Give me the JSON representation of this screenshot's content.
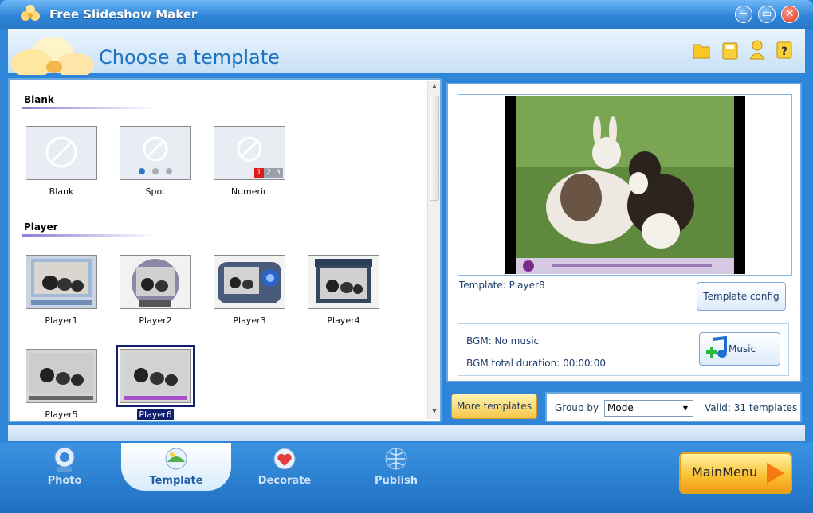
{
  "window": {
    "title": "Free Slideshow Maker",
    "controls": [
      "minimize",
      "maximize",
      "close"
    ]
  },
  "header": {
    "title": "Choose a template",
    "icons": [
      "folder-icon",
      "save-icon",
      "user-icon",
      "help-icon"
    ]
  },
  "templates": {
    "sections": [
      {
        "name": "Blank",
        "items": [
          {
            "label": "Blank"
          },
          {
            "label": "Spot"
          },
          {
            "label": "Numeric"
          }
        ]
      },
      {
        "name": "Player",
        "items": [
          {
            "label": "Player1"
          },
          {
            "label": "Player2"
          },
          {
            "label": "Player3"
          },
          {
            "label": "Player4"
          },
          {
            "label": "Player5"
          },
          {
            "label": "Player6",
            "selected": true
          }
        ]
      }
    ],
    "numeric_digits": [
      "1",
      "2",
      "3"
    ]
  },
  "preview": {
    "template_label": "Template:  Player8",
    "config_button": "Template config"
  },
  "bgm": {
    "music_line": "BGM: No music",
    "duration_line": "BGM total duration: 00:00:00",
    "music_button": "Music"
  },
  "controls": {
    "more_templates": "More templates",
    "group_by_label": "Group by",
    "group_by_value": "Mode",
    "valid_count": "Valid: 31 templates"
  },
  "tabs": [
    {
      "label": "Photo"
    },
    {
      "label": "Template",
      "active": true
    },
    {
      "label": "Decorate"
    },
    {
      "label": "Publish"
    }
  ],
  "main_menu": "MainMenu"
}
